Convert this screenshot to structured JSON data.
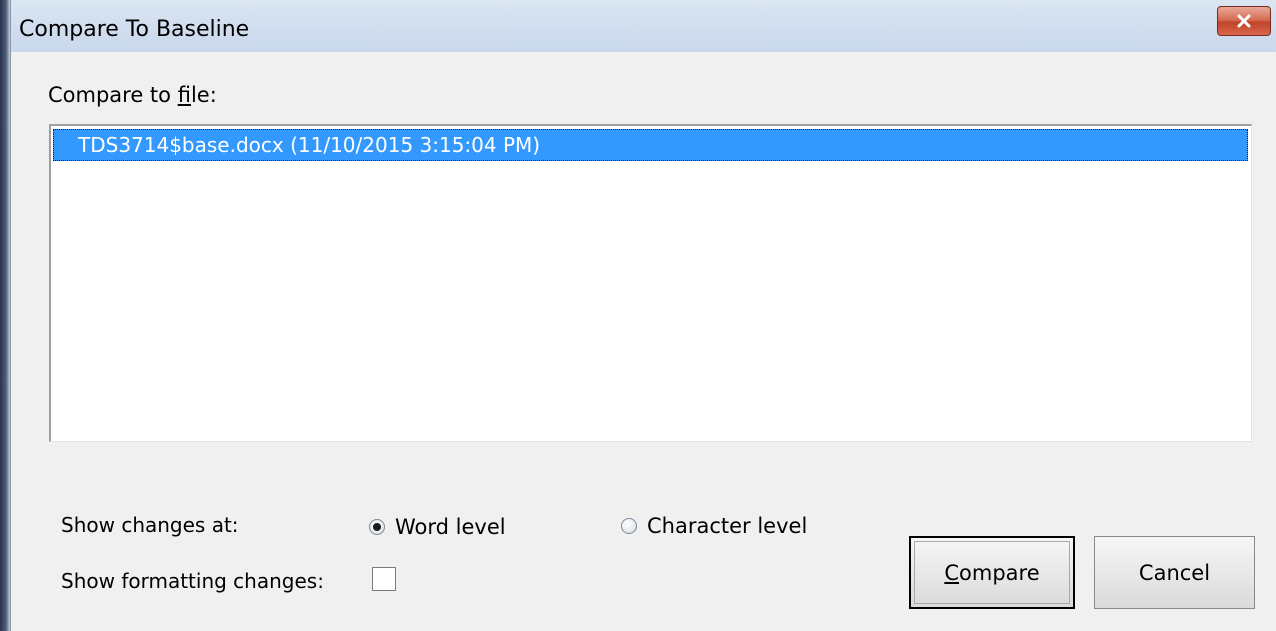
{
  "window": {
    "title": "Compare To Baseline",
    "close_icon": "close-icon"
  },
  "file_list": {
    "label_prefix": "Compare to ",
    "label_mnemonic": "f",
    "label_suffix": "ile:",
    "items": [
      {
        "text": "TDS3714$base.docx (11/10/2015 3:15:04 PM)",
        "selected": true
      }
    ]
  },
  "options": {
    "show_changes_label": "Show changes at:",
    "word_level_label": "Word level",
    "character_level_label": "Character level",
    "selected_level": "word",
    "show_formatting_label": "Show formatting changes:",
    "show_formatting_checked": false
  },
  "buttons": {
    "compare_mnemonic": "C",
    "compare_rest": "ompare",
    "cancel_label": "Cancel"
  },
  "colors": {
    "selection": "#3399ff",
    "close_button": "#c7452b"
  }
}
